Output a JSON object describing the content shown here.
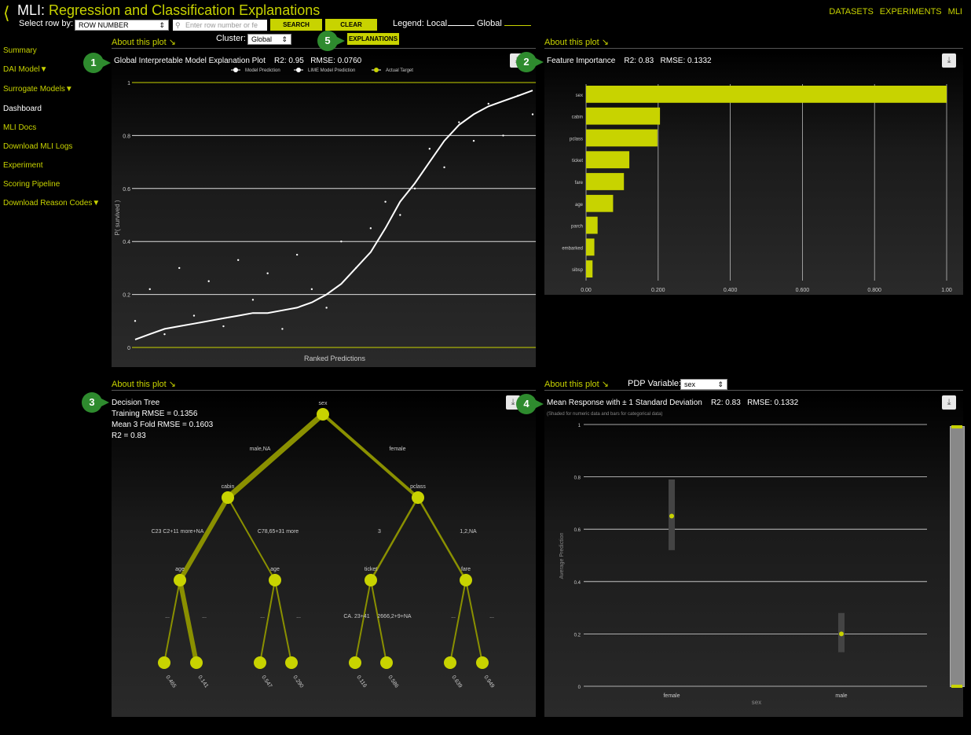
{
  "header": {
    "back_glyph": "⟨",
    "title_prefix": "MLI:",
    "title": "Regression and Classification Explanations",
    "select_row_label": "Select row by:",
    "select_row_value": "ROW NUMBER",
    "search_placeholder": "Enter row number or fe",
    "search_label": "SEARCH",
    "clear_label": "CLEAR",
    "legend_label": "Legend: Local",
    "legend_global": "Global",
    "nav": [
      "DATASETS",
      "EXPERIMENTS",
      "MLI"
    ]
  },
  "sidebar": {
    "items": [
      {
        "label": "Summary",
        "active": false
      },
      {
        "label": "DAI Model▼",
        "active": false
      },
      {
        "label": "Surrogate Models▼",
        "active": false
      },
      {
        "label": "Dashboard",
        "active": true
      },
      {
        "label": "MLI Docs",
        "active": false
      },
      {
        "label": "Download MLI Logs",
        "active": false
      },
      {
        "label": "Experiment",
        "active": false
      },
      {
        "label": "Scoring Pipeline",
        "active": false
      },
      {
        "label": "Download Reason Codes▼",
        "active": false
      }
    ]
  },
  "top_controls": {
    "cluster_label": "Cluster:",
    "cluster_value": "Global",
    "explanations_label": "EXPLANATIONS"
  },
  "badges": [
    "1",
    "2",
    "3",
    "4",
    "5"
  ],
  "about_label": "About this plot ↘",
  "panel1": {
    "title": "Global Interpretable Model Explanation Plot",
    "r2": "R2: 0.95",
    "rmse": "RMSE: 0.0760",
    "legend": [
      "Model Prediction",
      "LIME Model Prediction",
      "Actual Target"
    ],
    "ylabel": "P( survived )",
    "xlabel": "Ranked Predictions",
    "yticks": [
      "0",
      "0.2",
      "0.4",
      "0.6",
      "0.8",
      "1"
    ]
  },
  "panel2": {
    "title": "Feature Importance",
    "r2": "R2: 0.83",
    "rmse": "RMSE: 0.1332",
    "xticks": [
      "0.00",
      "0.200",
      "0.400",
      "0.600",
      "0.800",
      "1.00"
    ]
  },
  "panel3": {
    "title": "Decision Tree",
    "training_rmse": "Training RMSE = 0.1356",
    "mean_rmse": "Mean 3 Fold RMSE = 0.1603",
    "r2": "R2 = 0.83",
    "nodes": {
      "root": "sex",
      "l1_left": "cabin",
      "l1_right": "pclass",
      "l2": [
        "age",
        "age",
        "ticket",
        "fare"
      ]
    },
    "edges": {
      "root_left": "male,NA",
      "root_right": "female",
      "cabin_left": "C23 C2+11 more+NA",
      "cabin_right": "C78,65+31 more",
      "pclass_left": "3",
      "pclass_right": "1,2,NA",
      "l3": [
        "...",
        "...",
        "...",
        "...",
        "CA. 23+41",
        "2666,2+9+NA",
        "...",
        "..."
      ]
    },
    "leaves": [
      "0.465",
      "0.141",
      "0.547",
      "0.290",
      "0.116",
      "0.586",
      "0.639",
      "0.949"
    ]
  },
  "panel4": {
    "pdp_label": "PDP Variable:",
    "pdp_value": "sex",
    "title": "Mean Response with ± 1 Standard Deviation",
    "r2": "R2: 0.83",
    "rmse": "RMSE: 0.1332",
    "subtitle": "(Shaded for numeric data and bars for categorical data)",
    "ylabel": "Average Prediction",
    "xlabel": "sex",
    "yticks": [
      "0",
      "0.2",
      "0.4",
      "0.6",
      "0.8",
      "1"
    ],
    "categories": [
      "female",
      "male"
    ]
  },
  "chart_data": [
    {
      "type": "scatter",
      "title": "Global Interpretable Model Explanation Plot",
      "xlabel": "Ranked Predictions",
      "ylabel": "P( survived )",
      "ylim": [
        0,
        1
      ],
      "series": [
        {
          "name": "Model Prediction",
          "values": [
            0.03,
            0.05,
            0.07,
            0.08,
            0.09,
            0.1,
            0.11,
            0.12,
            0.13,
            0.13,
            0.14,
            0.15,
            0.17,
            0.2,
            0.24,
            0.3,
            0.36,
            0.45,
            0.55,
            0.62,
            0.7,
            0.78,
            0.84,
            0.88,
            0.91,
            0.93,
            0.95,
            0.97
          ]
        },
        {
          "name": "LIME Model Prediction",
          "values": [
            0.1,
            0.22,
            0.05,
            0.3,
            0.12,
            0.25,
            0.08,
            0.33,
            0.18,
            0.28,
            0.07,
            0.35,
            0.22,
            0.15,
            0.4,
            0.3,
            0.45,
            0.55,
            0.5,
            0.6,
            0.75,
            0.68,
            0.85,
            0.78,
            0.92,
            0.8,
            0.95,
            0.88
          ]
        },
        {
          "name": "Actual Target",
          "values": [
            0,
            1
          ]
        }
      ]
    },
    {
      "type": "bar",
      "title": "Feature Importance",
      "categories": [
        "sex",
        "cabin",
        "pclass",
        "ticket",
        "fare",
        "age",
        "parch",
        "embarked",
        "sibsp"
      ],
      "values": [
        1.0,
        0.205,
        0.198,
        0.12,
        0.105,
        0.075,
        0.032,
        0.023,
        0.018
      ],
      "xlim": [
        0,
        1
      ]
    },
    {
      "type": "scatter",
      "title": "Mean Response with ± 1 Standard Deviation",
      "xlabel": "sex",
      "ylabel": "Average Prediction",
      "categories": [
        "female",
        "male"
      ],
      "values": [
        0.65,
        0.2
      ],
      "error": [
        [
          0.52,
          0.79
        ],
        [
          0.13,
          0.28
        ]
      ],
      "ylim": [
        0,
        1
      ]
    }
  ]
}
